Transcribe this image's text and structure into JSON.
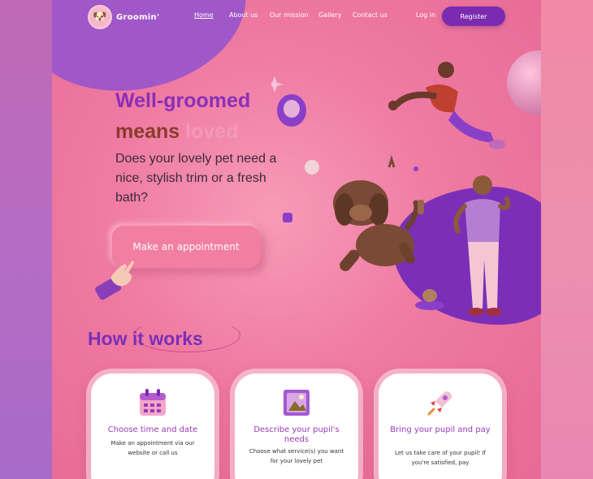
{
  "brand": {
    "name": "Groomin'"
  },
  "nav": {
    "items": [
      {
        "label": "Home",
        "active": true
      },
      {
        "label": "About us",
        "active": false
      },
      {
        "label": "Our mission",
        "active": false
      },
      {
        "label": "Gallery",
        "active": false
      },
      {
        "label": "Contact us",
        "active": false
      }
    ],
    "login_label": "Log in",
    "register_label": "Register"
  },
  "hero": {
    "title_line1": "Well-groomed",
    "title_line2a": "means ",
    "title_line2b": "loved",
    "subtitle": "Does your lovely pet need a nice, stylish trim or a fresh bath?",
    "cta_label": "Make an appointment"
  },
  "how": {
    "heading": "How it works",
    "cards": [
      {
        "title": "Choose time and date",
        "description": "Make an appointment via our website or call us",
        "icon": "calendar-icon"
      },
      {
        "title": "Describe your pupil's needs",
        "description": "Choose what service(s) you want for your lovely pet",
        "icon": "photo-icon"
      },
      {
        "title": "Bring your pupil and pay",
        "description": "Let us take care of your pupil! If you're satisfied, pay",
        "icon": "rocket-icon"
      }
    ]
  },
  "colors": {
    "accent": "#7a2bb0",
    "background": "#ef7aa2",
    "title_purple": "#8a2fb8",
    "title_brown": "#8a3b2e"
  }
}
